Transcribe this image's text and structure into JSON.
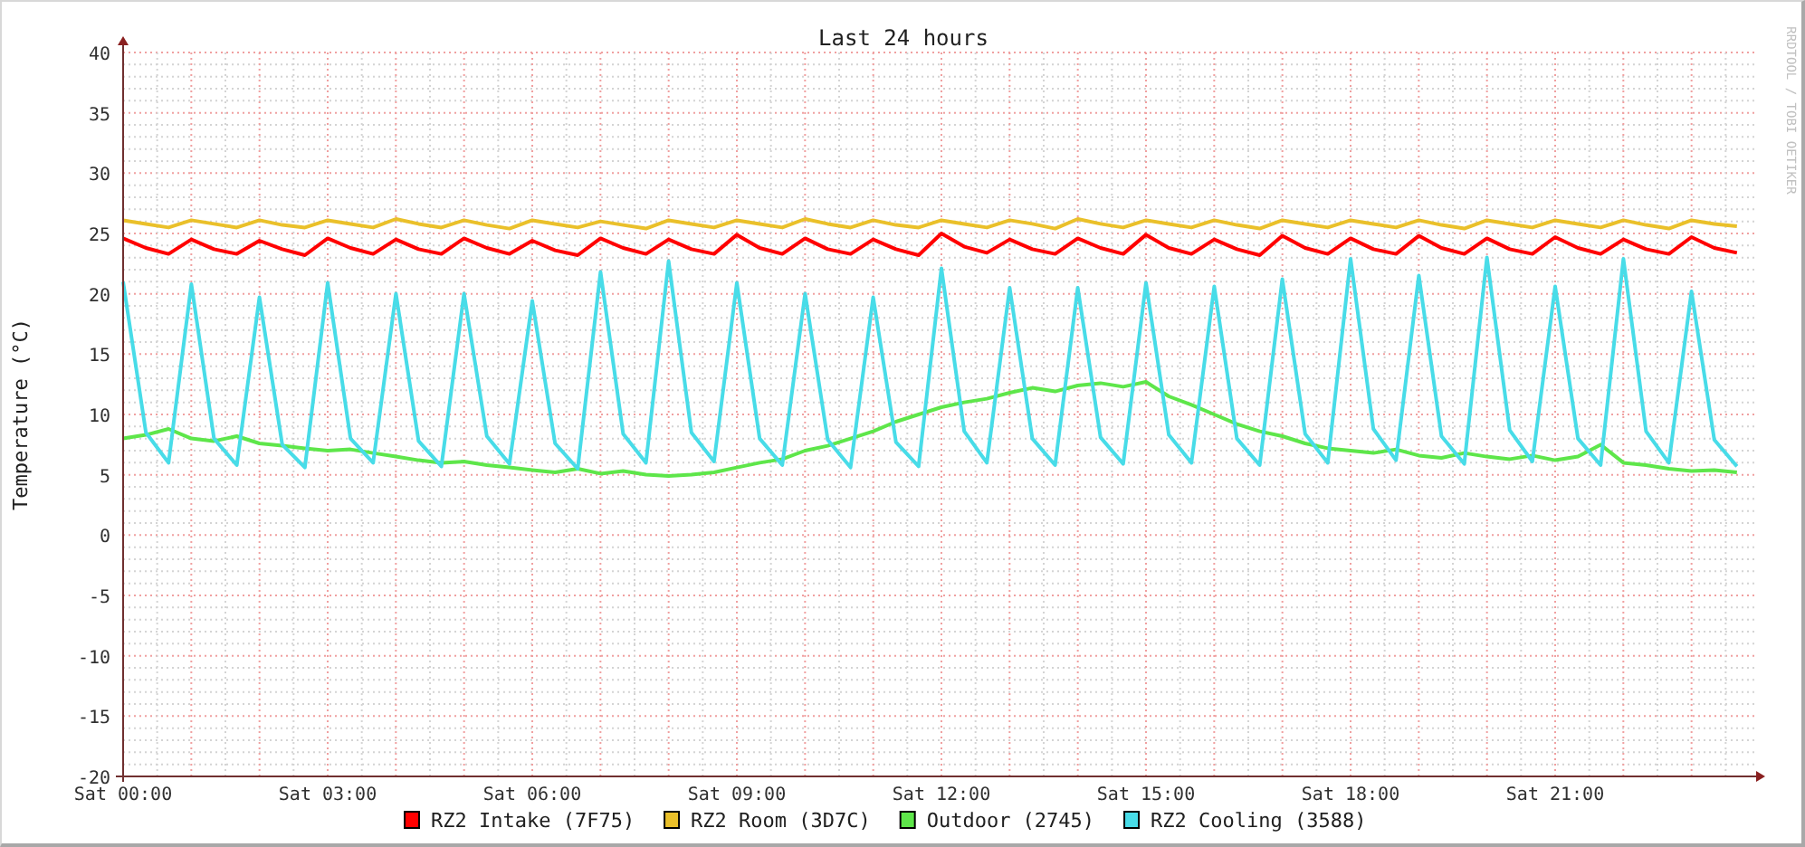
{
  "graph": {
    "credit": "RRDTOOL / TOBI OETIKER",
    "chart_data": {
      "type": "line",
      "title": "Last 24 hours",
      "ylabel": "Temperature (°C)",
      "categories": [
        "Sat 00:00",
        null,
        null,
        null,
        null,
        null,
        null,
        null,
        null,
        "Sat 03:00",
        null,
        null,
        null,
        null,
        null,
        null,
        null,
        null,
        "Sat 06:00",
        null,
        null,
        null,
        null,
        null,
        null,
        null,
        null,
        "Sat 09:00",
        null,
        null,
        null,
        null,
        null,
        null,
        null,
        null,
        "Sat 12:00",
        null,
        null,
        null,
        null,
        null,
        null,
        null,
        null,
        "Sat 15:00",
        null,
        null,
        null,
        null,
        null,
        null,
        null,
        null,
        "Sat 18:00",
        null,
        null,
        null,
        null,
        null,
        null,
        null,
        null,
        "Sat 21:00",
        null,
        null,
        null,
        null,
        null,
        null,
        null,
        null
      ],
      "series": [
        {
          "name": "RZ2 Intake (7F75)",
          "color": "#ff0000",
          "values": [
            24.6,
            23.8,
            23.3,
            24.5,
            23.7,
            23.3,
            24.4,
            23.7,
            23.2,
            24.6,
            23.8,
            23.3,
            24.5,
            23.7,
            23.3,
            24.6,
            23.8,
            23.3,
            24.4,
            23.6,
            23.2,
            24.6,
            23.8,
            23.3,
            24.5,
            23.7,
            23.3,
            24.9,
            23.8,
            23.3,
            24.6,
            23.7,
            23.3,
            24.5,
            23.7,
            23.2,
            25,
            23.9,
            23.4,
            24.5,
            23.7,
            23.3,
            24.6,
            23.8,
            23.3,
            24.9,
            23.8,
            23.3,
            24.5,
            23.7,
            23.2,
            24.8,
            23.8,
            23.3,
            24.6,
            23.7,
            23.3,
            24.8,
            23.8,
            23.3,
            24.6,
            23.7,
            23.3,
            24.7,
            23.8,
            23.3,
            24.5,
            23.7,
            23.3,
            24.7,
            23.8,
            23.4
          ]
        },
        {
          "name": "RZ2 Room (3D7C)",
          "color": "#eac02a",
          "values": [
            26.1,
            25.8,
            25.5,
            26.1,
            25.8,
            25.5,
            26.1,
            25.7,
            25.5,
            26.1,
            25.8,
            25.5,
            26.2,
            25.8,
            25.5,
            26.1,
            25.7,
            25.4,
            26.1,
            25.8,
            25.5,
            26,
            25.7,
            25.4,
            26.1,
            25.8,
            25.5,
            26.1,
            25.8,
            25.5,
            26.2,
            25.8,
            25.5,
            26.1,
            25.7,
            25.5,
            26.1,
            25.8,
            25.5,
            26.1,
            25.8,
            25.4,
            26.2,
            25.8,
            25.5,
            26.1,
            25.8,
            25.5,
            26.1,
            25.7,
            25.4,
            26.1,
            25.8,
            25.5,
            26.1,
            25.8,
            25.5,
            26.1,
            25.7,
            25.4,
            26.1,
            25.8,
            25.5,
            26.1,
            25.8,
            25.5,
            26.1,
            25.7,
            25.4,
            26.1,
            25.8,
            25.6
          ]
        },
        {
          "name": "Outdoor (2745)",
          "color": "#5ee64a",
          "values": [
            8,
            8.3,
            8.8,
            8,
            7.8,
            8.2,
            7.6,
            7.4,
            7.2,
            7,
            7.1,
            6.8,
            6.5,
            6.2,
            6,
            6.1,
            5.8,
            5.6,
            5.4,
            5.2,
            5.5,
            5.1,
            5.3,
            5,
            4.9,
            5,
            5.2,
            5.6,
            6,
            6.3,
            7,
            7.4,
            8,
            8.6,
            9.4,
            10,
            10.6,
            11,
            11.3,
            11.8,
            12.2,
            11.9,
            12.4,
            12.6,
            12.3,
            12.7,
            11.5,
            10.8,
            10,
            9.2,
            8.6,
            8.2,
            7.6,
            7.2,
            7,
            6.8,
            7.1,
            6.6,
            6.4,
            6.8,
            6.5,
            6.3,
            6.6,
            6.2,
            6.5,
            7.5,
            6,
            5.8,
            5.5,
            5.3,
            5.4,
            5.2
          ]
        },
        {
          "name": "RZ2 Cooling (3588)",
          "color": "#48dce8",
          "values": [
            21,
            8.5,
            6,
            20.8,
            8,
            5.8,
            19.7,
            7.5,
            5.6,
            20.9,
            8,
            6,
            20,
            7.8,
            5.7,
            20,
            8.2,
            5.9,
            19.4,
            7.6,
            5.5,
            21.8,
            8.4,
            6,
            22.7,
            8.5,
            6.1,
            20.9,
            8,
            5.8,
            20,
            7.9,
            5.6,
            19.7,
            7.7,
            5.7,
            22.1,
            8.6,
            6,
            20.5,
            8,
            5.8,
            20.5,
            8.1,
            5.9,
            20.9,
            8.3,
            6,
            20.6,
            8,
            5.8,
            21.2,
            8.4,
            6,
            22.9,
            8.8,
            6.2,
            21.5,
            8.2,
            5.9,
            23,
            8.7,
            6.1,
            20.6,
            8,
            5.8,
            22.9,
            8.6,
            6,
            20.2,
            7.9,
            5.7
          ]
        }
      ],
      "ylim": [
        -20,
        40
      ],
      "grid": true,
      "legend": "bottom",
      "yticks": [
        -20,
        -15,
        -10,
        -5,
        0,
        5,
        10,
        15,
        20,
        25,
        30,
        35,
        40
      ]
    }
  }
}
